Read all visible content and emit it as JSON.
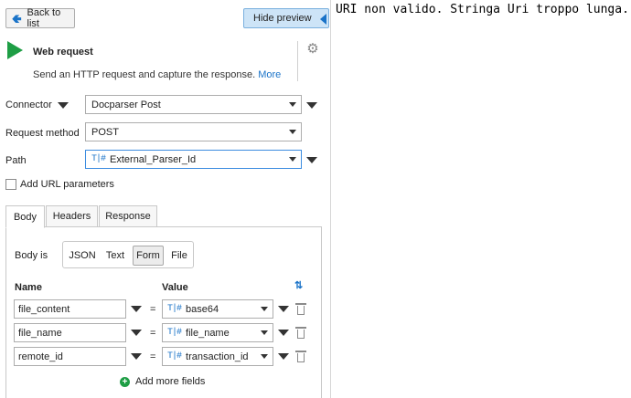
{
  "toolbar": {
    "back_label": "Back to list",
    "hide_preview_label": "Hide preview"
  },
  "action": {
    "title": "Web request",
    "description": "Send an HTTP request and capture the response.",
    "more_link": "More"
  },
  "form": {
    "connector_label": "Connector",
    "connector_value": "Docparser Post",
    "method_label": "Request method",
    "method_value": "POST",
    "path_label": "Path",
    "path_value": "External_Parser_Id",
    "add_url_params_label": "Add URL parameters"
  },
  "tabs": [
    {
      "label": "Body",
      "active": true
    },
    {
      "label": "Headers",
      "active": false
    },
    {
      "label": "Response",
      "active": false
    }
  ],
  "body": {
    "body_is_label": "Body is",
    "types": [
      "JSON",
      "Text",
      "Form",
      "File"
    ],
    "selected_type": "Form",
    "name_header": "Name",
    "value_header": "Value",
    "fields": [
      {
        "name": "file_content",
        "eq": "=",
        "value": "base64"
      },
      {
        "name": "file_name",
        "eq": "=",
        "value": "file_name"
      },
      {
        "name": "remote_id",
        "eq": "=",
        "value": "transaction_id"
      }
    ],
    "add_more_label": "Add more fields"
  },
  "preview": {
    "error_text": "URI non valido. Stringa Uri troppo lunga."
  },
  "colors": {
    "accent": "#1a73c8",
    "green": "#1e9e45",
    "hide_preview_bg": "#cde4f7"
  }
}
